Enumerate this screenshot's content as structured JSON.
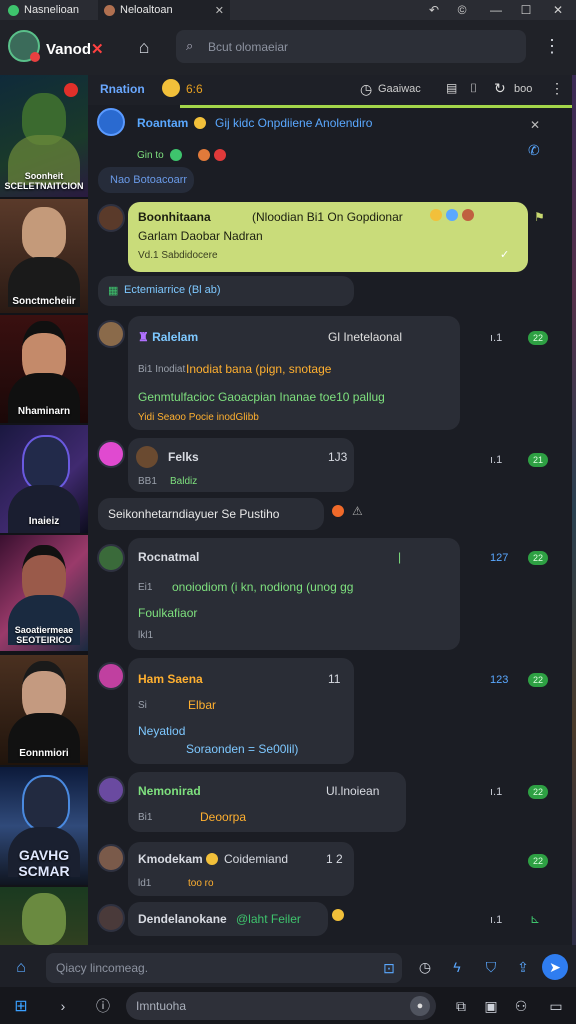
{
  "window": {
    "tabs": [
      {
        "label": "Nasnelioan",
        "active": false,
        "icon": "app-icon"
      },
      {
        "label": "Neloaltoan",
        "active": true,
        "icon": "avatar-icon"
      }
    ],
    "controls": {
      "minimize": "—",
      "maximize": "☐",
      "close": "✕"
    }
  },
  "header": {
    "brand_name": "Vanod",
    "brand_mark": "✕",
    "search_placeholder": "Bcut olomaeiar",
    "menu_icon": "⋮"
  },
  "thumbnails": [
    {
      "caption": "Soonheit\nSCELETNAITCION",
      "palette": [
        "#0f2a3a",
        "#3b6a2f",
        "#6d8a3a"
      ]
    },
    {
      "caption": "Sonctmcheiir",
      "palette": [
        "#5a3a2a",
        "#c49a7a",
        "#1a1a1a"
      ]
    },
    {
      "caption": "Nhaminarn",
      "palette": [
        "#3a1010",
        "#c48a6a",
        "#101010"
      ]
    },
    {
      "caption": "Inaieiz",
      "palette": [
        "#1a1840",
        "#402a70",
        "#0c0c1c"
      ]
    },
    {
      "caption": "Saoatiermeae\nSEOTEIRICO",
      "palette": [
        "#3a1030",
        "#9a5a4a",
        "#1a2a40"
      ]
    },
    {
      "caption": "Eonnmiori",
      "palette": [
        "#4a3020",
        "#c49a80",
        "#111111"
      ]
    },
    {
      "caption": "GAVHG\nSCMAR",
      "palette": [
        "#0c1a3a",
        "#304a7a",
        "#101520"
      ]
    },
    {
      "caption": "",
      "palette": [
        "#1a3a20",
        "#6a8a40",
        "#304020"
      ]
    }
  ],
  "chat_toolbar": {
    "title": "Rnation",
    "count": "6:6",
    "label_right": "Gaaiwac",
    "tool_text": "boo",
    "icons": [
      "clock-icon",
      "doc-icon",
      "pipe-icon",
      "sync-icon",
      "more-icon"
    ]
  },
  "messages": [
    {
      "name": "Roantam",
      "name_color": "#5aa8ff",
      "text": "Gij kidc Onpdiiene Anolendiro",
      "sub": "Gin  to",
      "time": "",
      "badge": "",
      "chip": "Nao Botoacoarr",
      "right_icon": "phone-icon"
    },
    {
      "name": "Boonhitaana",
      "name_color": "#1c1f10",
      "text": "(Nloodian Bi1 On   Gopdionar",
      "sub": "Garlam Daobar Nadran",
      "sub2": "Vd.1   Sabdidocere",
      "time": "",
      "badge": "",
      "chip": "Ectemiarrice  (Bl ab)",
      "right_icon": "pin-icon"
    },
    {
      "name": "Ralelam",
      "name_color": "#7ec8ff",
      "header_right": "Gl Inetelaonal",
      "text": "Inodiat bana  (pign,  snotage",
      "text2": "Genmtulfacioc  Gaoacpian Inanae   toe10 pallug",
      "sub": "Bi1   Inodiat",
      "sub2": "Yidi   Seaoo Pocie inodGlibb",
      "time": "ı.1",
      "badge": "22"
    },
    {
      "name": "Felks",
      "name_color": "#ffffff",
      "header_right": "1J3",
      "text": "Baldiz",
      "sub": "BB1",
      "chip": "Seikonhetarndiayuer   Se Pustiho",
      "time": "ı.1",
      "badge": "21"
    },
    {
      "name": "Rocnatmal",
      "name_color": "#7ee07e",
      "header_right": "|",
      "text": "onoiodiom  (i kn,  nodiong   (unog gg",
      "text2": "Foulkafiaor",
      "sub": "Ei1",
      "sub2": "lkl1",
      "time": "127",
      "time_color": "#5aa8ff",
      "badge": "22"
    },
    {
      "name": "Ham Saena",
      "name_color": "#ffb030",
      "header_right": "11",
      "text": "Elbar",
      "text2": "Neyatiod",
      "text3": "Soraonden  =  Se00lil)",
      "sub": "Si",
      "time": "123",
      "time_color": "#5aa8ff",
      "badge": "22"
    },
    {
      "name": "Nemonirad",
      "name_color": "#7ee07e",
      "header_right": "Ul.lnoiean",
      "text": "Deoorpa",
      "sub": "Bi1",
      "time": "ı.1",
      "badge": "22"
    },
    {
      "name": "Kmodekam",
      "name_color": "#ffffff",
      "header_right": "1 2",
      "text": "Coidemiand",
      "text2": "too ro",
      "sub": "ld1",
      "time": "",
      "badge": "22"
    },
    {
      "name": "Dendelanokane",
      "name_color": "#ffffff",
      "text": "@laht Feiler",
      "sub": "",
      "time": "ı.1",
      "badge": ""
    }
  ],
  "composer": {
    "placeholder": "Qiacy lincomeag.",
    "icons": [
      "home-icon",
      "attach-icon",
      "clock-icon",
      "bolt-icon",
      "shield-icon",
      "share-icon",
      "send-icon"
    ]
  },
  "taskbar": {
    "search_text": "Imntuoha",
    "icons": [
      "windows-icon",
      "chevron-icon",
      "info-icon",
      "mic-icon",
      "apps-icon",
      "camera-icon",
      "group-icon",
      "monitor-icon"
    ]
  }
}
